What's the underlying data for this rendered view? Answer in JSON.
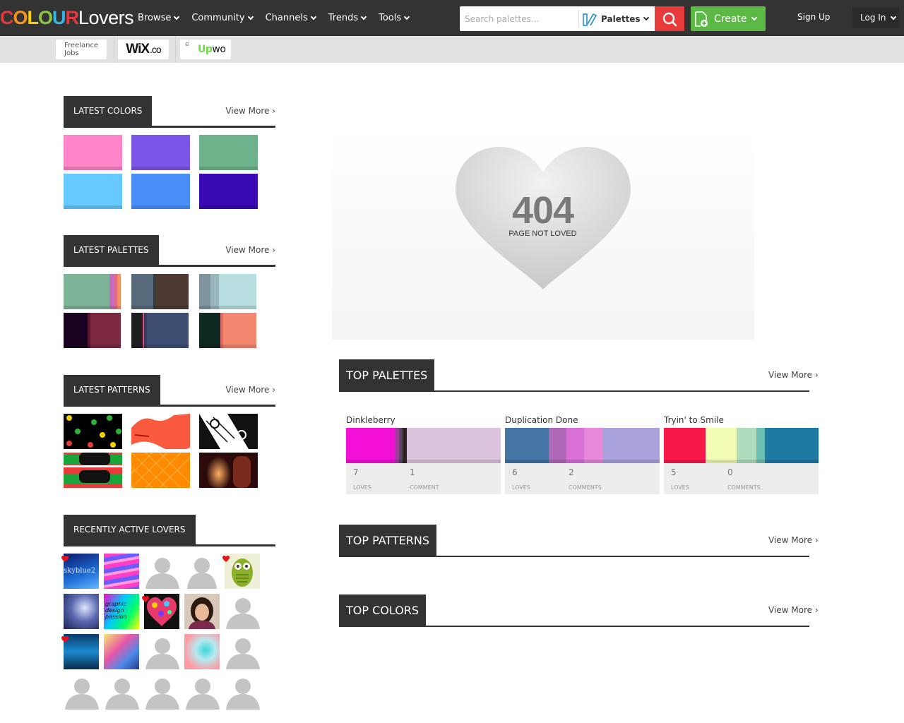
{
  "header": {
    "logo_letters": [
      {
        "ch": "C",
        "color": "#e8363f"
      },
      {
        "ch": "O",
        "color": "#f7941d"
      },
      {
        "ch": "L",
        "color": "#fdd000"
      },
      {
        "ch": "O",
        "color": "#8dc63f"
      },
      {
        "ch": "U",
        "color": "#33b5e5"
      },
      {
        "ch": "R",
        "color": "#e8363f"
      }
    ],
    "logo_rest": "Lovers",
    "nav": [
      "Browse",
      "Community",
      "Channels",
      "Trends",
      "Tools"
    ],
    "search_placeholder": "Search palettes...",
    "search_type": "Palettes",
    "create": "Create",
    "signup": "Sign Up",
    "login": "Log In"
  },
  "ads": {
    "ad1_line1": "Freelance",
    "ad1_line2": "Jobs",
    "ad2_main": "WiX",
    "ad2_suffix": ".co",
    "ad3_e": "e",
    "ad3_up": "Up",
    "ad3_wo": "wo"
  },
  "left": {
    "latest_colors": {
      "title": "Latest Colors",
      "more": "View More ›",
      "colors": [
        "#ff85c8",
        "#7a55e8",
        "#6db28a",
        "#66c9ff",
        "#4a8ff7",
        "#3a0bb4"
      ]
    },
    "latest_palettes": {
      "title": "Latest Palettes",
      "more": "View More ›",
      "palettes": [
        [
          [
            "#7fb397",
            65
          ],
          [
            "#c76bc0",
            6
          ],
          [
            "#e26a8a",
            5
          ],
          [
            "#f48e67",
            5
          ]
        ],
        [
          [
            "#566a7c",
            31
          ],
          [
            "#3c3a3a",
            4
          ],
          [
            "#4e3a33",
            46
          ]
        ],
        [
          [
            "#7e939e",
            16
          ],
          [
            "#98b6bb",
            12
          ],
          [
            "#b8dde0",
            53
          ]
        ],
        [
          [
            "#1a0320",
            34
          ],
          [
            "#57162e",
            4
          ],
          [
            "#7b2840",
            43
          ]
        ],
        [
          [
            "#1e1e21",
            16
          ],
          [
            "#e04e7a",
            2
          ],
          [
            "#3a3960",
            4
          ],
          [
            "#3d4e72",
            59
          ]
        ],
        [
          [
            "#0d2a23",
            30
          ],
          [
            "#e86868",
            4
          ],
          [
            "#f48770",
            47
          ]
        ]
      ]
    },
    "latest_patterns": {
      "title": "Latest Patterns",
      "more": "View More ›"
    },
    "recent_lovers": {
      "title": "Recently Active Lovers",
      "avatar_text_1": "skyblue2",
      "avatar_text_2": "graphic design passion"
    }
  },
  "error": {
    "code": "404",
    "message": "PAGE NOT LOVED"
  },
  "right": {
    "top_palettes": {
      "title": "Top Palettes",
      "more": "View More ›",
      "cards": [
        {
          "name": "Dinkleberry",
          "colors": [
            [
              "#f40fd6",
              69
            ],
            [
              "#9a3f9a",
              6
            ],
            [
              "#574760",
              5
            ],
            [
              "#2e2226",
              6
            ],
            [
              "#dcc3dc",
              133
            ]
          ],
          "loves": "7",
          "loves_label": "Loves",
          "comments": "1",
          "comments_label": "Comment"
        },
        {
          "name": "Duplication Done",
          "colors": [
            [
              "#4475a4",
              62
            ],
            [
              "#b068b8",
              25
            ],
            [
              "#d870d6",
              25
            ],
            [
              "#e888d8",
              26
            ],
            [
              "#aaa2dc",
              81
            ]
          ],
          "loves": "6",
          "loves_label": "Loves",
          "comments": "2",
          "comments_label": "Comments"
        },
        {
          "name": "Tryin' to Smile",
          "colors": [
            [
              "#f8194a",
              59
            ],
            [
              "#f2fcb4",
              44
            ],
            [
              "#aedcbc",
              28
            ],
            [
              "#6fc0b4",
              12
            ],
            [
              "#1e7aa2",
              76
            ]
          ],
          "loves": "5",
          "loves_label": "Loves",
          "comments": "0",
          "comments_label": "Comments"
        }
      ]
    },
    "top_patterns": {
      "title": "Top Patterns",
      "more": "View More ›"
    },
    "top_colors": {
      "title": "Top Colors",
      "more": "View More ›"
    }
  }
}
